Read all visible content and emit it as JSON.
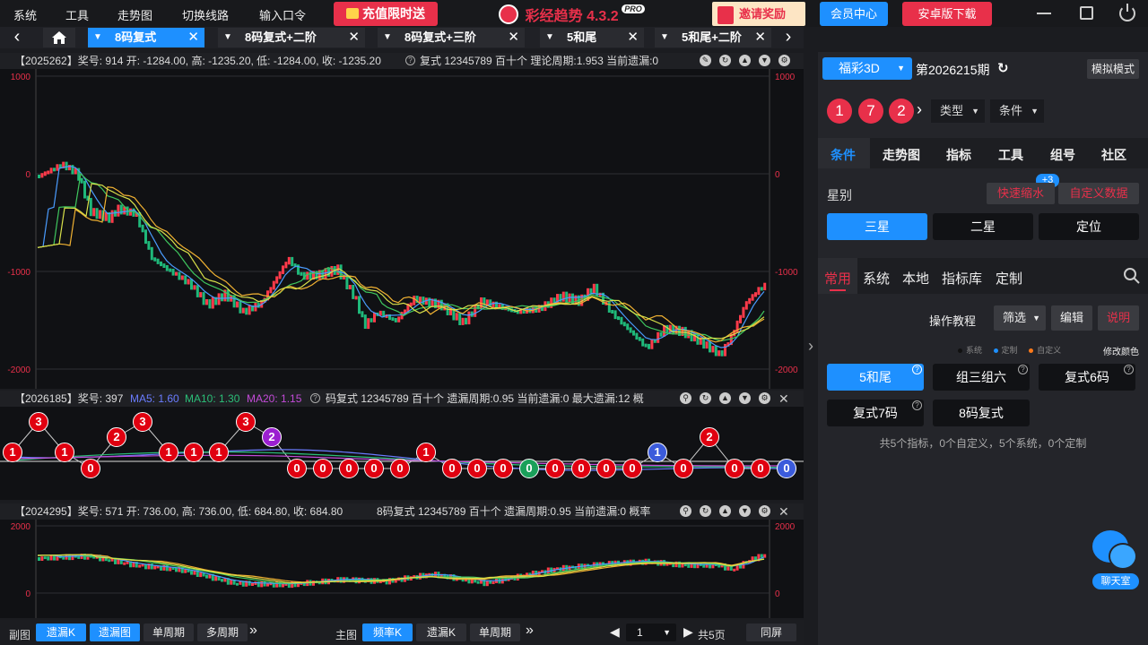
{
  "menubar": {
    "items": [
      "系统",
      "工具",
      "走势图",
      "切换线路",
      "输入口令"
    ],
    "promo_label": "充值限时送",
    "app_title": "彩经趋势 4.3.2",
    "pro_badge": "PRO",
    "invite_label": "邀请奖励",
    "member_label": "会员中心",
    "android_label": "安卓版下载"
  },
  "tabs": [
    {
      "label": "8码复式",
      "active": true
    },
    {
      "label": "8码复式+二阶",
      "active": false
    },
    {
      "label": "8码复式+三阶",
      "active": false
    },
    {
      "label": "5和尾",
      "active": false
    },
    {
      "label": "5和尾+二阶",
      "active": false
    }
  ],
  "panel1": {
    "header": "【2025262】奖号: 914   开: -1284.00, 高: -1235.20, 低: -1284.00, 收: -1235.20",
    "header2": "复式   12345789   百十个   理论周期:1.953   当前遗漏:0",
    "y_ticks": [
      "1000",
      "0",
      "-1000",
      "-2000"
    ]
  },
  "panel2": {
    "header_prefix": "【2026185】奖号: 397",
    "ma5": "MA5: 1.60",
    "ma10": "MA10: 1.30",
    "ma20": "MA20: 1.15",
    "header_suffix": "码复式   12345789   百十个   遗漏周期:0.95   当前遗漏:0   最大遗漏:12   概"
  },
  "panel3": {
    "header": "【2024295】奖号: 571   开: 736.00, 高: 736.00, 低: 684.80, 收: 684.80",
    "header2": "8码复式   12345789   百十个   遗漏周期:0.95   当前遗漏:0   概率",
    "y_ticks": [
      "2000",
      "0"
    ]
  },
  "balls": [
    {
      "v": "1",
      "c": "#e00010"
    },
    {
      "v": "3",
      "c": "#e00010"
    },
    {
      "v": "1",
      "c": "#e00010"
    },
    {
      "v": "0",
      "c": "#e00010"
    },
    {
      "v": "2",
      "c": "#e00010"
    },
    {
      "v": "3",
      "c": "#e00010"
    },
    {
      "v": "1",
      "c": "#e00010"
    },
    {
      "v": "1",
      "c": "#e00010"
    },
    {
      "v": "1",
      "c": "#e00010"
    },
    {
      "v": "3",
      "c": "#e00010"
    },
    {
      "v": "2",
      "c": "#9b1fd0"
    },
    {
      "v": "0",
      "c": "#e00010"
    },
    {
      "v": "0",
      "c": "#e00010"
    },
    {
      "v": "0",
      "c": "#e00010"
    },
    {
      "v": "0",
      "c": "#e00010"
    },
    {
      "v": "0",
      "c": "#e00010"
    },
    {
      "v": "1",
      "c": "#e00010"
    },
    {
      "v": "0",
      "c": "#e00010"
    },
    {
      "v": "0",
      "c": "#e00010"
    },
    {
      "v": "0",
      "c": "#e00010"
    },
    {
      "v": "0",
      "c": "#1aa05a"
    },
    {
      "v": "0",
      "c": "#e00010"
    },
    {
      "v": "0",
      "c": "#e00010"
    },
    {
      "v": "0",
      "c": "#e00010"
    },
    {
      "v": "0",
      "c": "#e00010"
    },
    {
      "v": "1",
      "c": "#3b5bdb"
    },
    {
      "v": "0",
      "c": "#e00010"
    },
    {
      "v": "2",
      "c": "#e00010"
    },
    {
      "v": "0",
      "c": "#e00010"
    },
    {
      "v": "0",
      "c": "#e00010"
    },
    {
      "v": "0",
      "c": "#3b5bdb"
    }
  ],
  "bottombar": {
    "sub_label": "副图",
    "sub_buttons": [
      "遗漏K",
      "遗漏图",
      "单周期",
      "多周期"
    ],
    "main_label": "主图",
    "main_buttons": [
      "频率K",
      "遗漏K",
      "单周期"
    ],
    "page_value": "1",
    "total_pages": "共5页",
    "sync_label": "同屏"
  },
  "right": {
    "lottery": "福彩3D",
    "period": "第2026215期",
    "sim_mode": "模拟模式",
    "numbers": [
      "1",
      "7",
      "2"
    ],
    "type_label": "类型",
    "cond_label": "条件",
    "main_tabs": [
      "条件",
      "走势图",
      "指标",
      "工具",
      "组号",
      "社区"
    ],
    "star_label": "星别",
    "badge": "+3",
    "quick_shrink": "快速缩水",
    "custom_data": "自定义数据",
    "star_options": [
      "三星",
      "二星",
      "定位"
    ],
    "sub_tabs": [
      "常用",
      "系统",
      "本地",
      "指标库",
      "定制"
    ],
    "tutorial": "操作教程",
    "filter": "筛选",
    "edit": "编辑",
    "explain": "说明",
    "legend": [
      "系统",
      "定制",
      "自定义"
    ],
    "legend_colors": [
      "#111111",
      "#1e90ff",
      "#ff7a1a"
    ],
    "modify_color": "修改颜色",
    "indicators": [
      "5和尾",
      "组三组六",
      "复式6码",
      "复式7码",
      "8码复式"
    ],
    "summary": "共5个指标，0个自定义，5个系统，0个定制",
    "chat_label": "聊天室"
  }
}
